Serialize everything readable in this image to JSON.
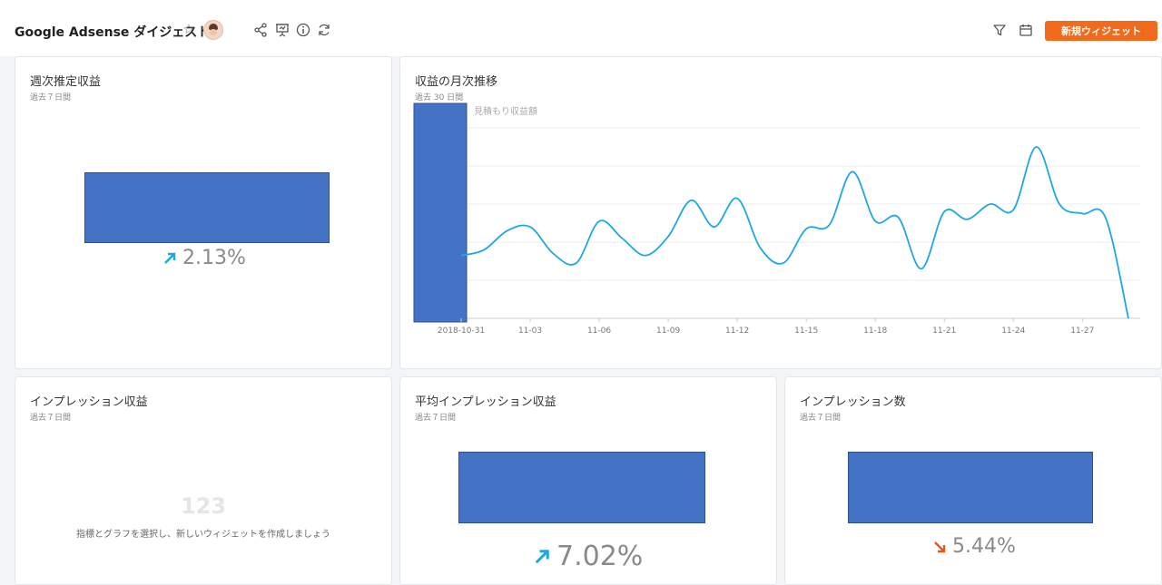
{
  "header": {
    "title": "Google Adsense ダイジェスト",
    "new_widget_label": "新規ウィジェット"
  },
  "colors": {
    "accent": "#f26b1d",
    "line": "#1ea7e1",
    "box": "#4472c4",
    "up": "#1ea7e1",
    "down": "#e8541c"
  },
  "cards": {
    "weekly": {
      "title": "週次推定収益",
      "subtitle": "過去７日間",
      "change": "2.13%",
      "direction": "up"
    },
    "monthly": {
      "title": "収益の月次推移",
      "subtitle": "過去 30 日間",
      "legend": "見積もり収益額"
    },
    "impression_revenue": {
      "title": "インプレッション収益",
      "subtitle": "過去７日間",
      "empty_number": "123",
      "empty_message": "指標とグラフを選択し、新しいウィジェットを作成しましょう"
    },
    "avg_impression": {
      "title": "平均インプレッション収益",
      "subtitle": "過去７日間",
      "change": "7.02%",
      "direction": "up"
    },
    "impressions": {
      "title": "インプレッション数",
      "subtitle": "過去７日間",
      "change": "5.44%",
      "direction": "down"
    }
  },
  "chart_data": {
    "type": "line",
    "title": "収益の月次推移",
    "x": [
      "2018-10-31",
      "2018-11-01",
      "2018-11-02",
      "2018-11-03",
      "2018-11-04",
      "2018-11-05",
      "2018-11-06",
      "2018-11-07",
      "2018-11-08",
      "2018-11-09",
      "2018-11-10",
      "2018-11-11",
      "2018-11-12",
      "2018-11-13",
      "2018-11-14",
      "2018-11-15",
      "2018-11-16",
      "2018-11-17",
      "2018-11-18",
      "2018-11-19",
      "2018-11-20",
      "2018-11-21",
      "2018-11-22",
      "2018-11-23",
      "2018-11-24",
      "2018-11-25",
      "2018-11-26",
      "2018-11-27",
      "2018-11-28",
      "2018-11-29"
    ],
    "tick_labels": [
      "2018-10-31",
      "11-03",
      "11-06",
      "11-09",
      "11-12",
      "11-15",
      "11-18",
      "11-21",
      "11-24",
      "11-27"
    ],
    "series": [
      {
        "name": "見積もり収益額",
        "values": [
          33,
          36,
          46,
          48,
          34,
          29,
          51,
          42,
          33,
          43,
          62,
          48,
          63,
          37,
          29,
          47,
          49,
          77,
          51,
          53,
          26,
          56,
          52,
          60,
          57,
          90,
          60,
          55,
          53,
          0
        ]
      }
    ],
    "ylim": [
      0,
      100
    ],
    "grid": true
  }
}
